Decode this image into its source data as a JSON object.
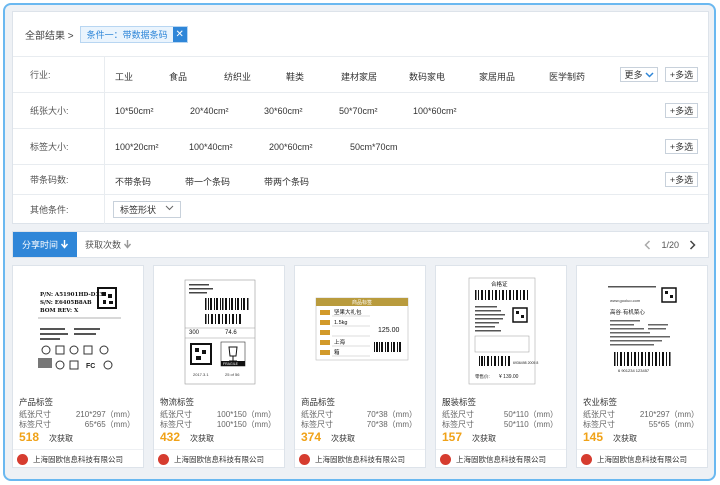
{
  "breadcrumb": {
    "all": "全部结果 >",
    "chip": "条件一：带数据条码",
    "chip_close": "✕"
  },
  "filters": {
    "industry": {
      "label": "行业:",
      "options": [
        "工业",
        "食品",
        "纺织业",
        "鞋类",
        "建材家居",
        "数码家电",
        "家居用品",
        "医学制药"
      ],
      "more": "更多",
      "multi": "+多选"
    },
    "paper_size": {
      "label": "纸张大小:",
      "options": [
        "10*50cm²",
        "20*40cm²",
        "30*60cm²",
        "50*70cm²",
        "100*60cm²"
      ],
      "multi": "+多选"
    },
    "label_size": {
      "label": "标签大小:",
      "options": [
        "100*20cm²",
        "100*40cm²",
        "200*60cm²",
        "50cm*70cm"
      ],
      "multi": "+多选"
    },
    "barcode": {
      "label": "带条码数:",
      "options": [
        "不带条码",
        "带一个条码",
        "带两个条码"
      ],
      "multi": "+多选"
    },
    "other": {
      "label": "其他条件:",
      "select": "标签形状"
    }
  },
  "sortbar": {
    "active": "分享时间",
    "other": "获取次数",
    "page": "1/20"
  },
  "cards": [
    {
      "title": "产品标签",
      "paper_label": "纸张尺寸",
      "paper": "210*297（mm）",
      "tag_label": "标签尺寸",
      "tag": "65*65（mm）",
      "count": "518",
      "count_unit": "次获取",
      "company": "上海固欧信息科技有限公司",
      "thumb": {
        "l1": "P/N: A51901HD-D33",
        "l2": "S/N: E6405B8AB",
        "l3": "BOM REV: X",
        "fcc": "FC"
      }
    },
    {
      "title": "物流标签",
      "paper_label": "纸张尺寸",
      "paper": "100*150（mm）",
      "tag_label": "标签尺寸",
      "tag": "100*150（mm）",
      "count": "432",
      "count_unit": "次获取",
      "company": "上海固欧信息科技有限公司",
      "thumb": {
        "qty": "300",
        "weight": "74.6",
        "fragile": "FRAGILE",
        "date": "2017.3.1",
        "box": "25 of 56"
      }
    },
    {
      "title": "商品标签",
      "paper_label": "纸张尺寸",
      "paper": "70*38（mm）",
      "tag_label": "标签尺寸",
      "tag": "70*38（mm）",
      "count": "374",
      "count_unit": "次获取",
      "company": "上海固欧信息科技有限公司",
      "thumb": {
        "header": "商品标签",
        "name": "坚果大礼包",
        "weight": "1.5kg",
        "origin": "上海",
        "price": "125.00",
        "unit": "箱"
      }
    },
    {
      "title": "服装标签",
      "paper_label": "纸张尺寸",
      "paper": "50*110（mm）",
      "tag_label": "标签尺寸",
      "tag": "50*110（mm）",
      "count": "157",
      "count_unit": "次获取",
      "company": "上海固欧信息科技有限公司",
      "thumb": {
        "header": "合格证",
        "price": "¥ 139.00",
        "price_label": "零售价:",
        "code": "6936498 2005 8"
      }
    },
    {
      "title": "农业标签",
      "paper_label": "纸张尺寸",
      "paper": "210*297（mm）",
      "tag_label": "标签尺寸",
      "tag": "55*65（mm）",
      "count": "145",
      "count_unit": "次获取",
      "company": "上海固欧信息科技有限公司",
      "thumb": {
        "title": "高谷·有机菜心",
        "url": "www.gooluo.com",
        "code": "6 901234 123457"
      }
    }
  ],
  "colors": {
    "accent": "#2f86d8",
    "count": "#f0a218",
    "frame": "#6ab8f0"
  }
}
